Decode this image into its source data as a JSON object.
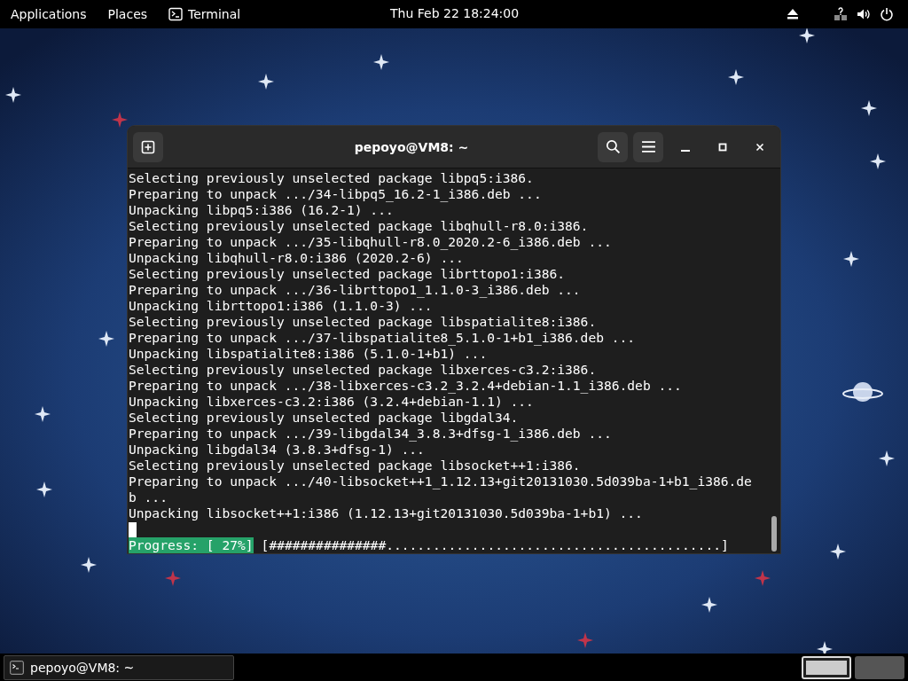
{
  "top_bar": {
    "menus": [
      {
        "label": "Applications"
      },
      {
        "label": "Places"
      }
    ],
    "app": {
      "label": "Terminal"
    },
    "clock": "Thu Feb 22  18:24:00"
  },
  "terminal": {
    "title": "pepoyo@VM8: ~",
    "lines": [
      "Selecting previously unselected package libpq5:i386.",
      "Preparing to unpack .../34-libpq5_16.2-1_i386.deb ...",
      "Unpacking libpq5:i386 (16.2-1) ...",
      "Selecting previously unselected package libqhull-r8.0:i386.",
      "Preparing to unpack .../35-libqhull-r8.0_2020.2-6_i386.deb ...",
      "Unpacking libqhull-r8.0:i386 (2020.2-6) ...",
      "Selecting previously unselected package librttopo1:i386.",
      "Preparing to unpack .../36-librttopo1_1.1.0-3_i386.deb ...",
      "Unpacking librttopo1:i386 (1.1.0-3) ...",
      "Selecting previously unselected package libspatialite8:i386.",
      "Preparing to unpack .../37-libspatialite8_5.1.0-1+b1_i386.deb ...",
      "Unpacking libspatialite8:i386 (5.1.0-1+b1) ...",
      "Selecting previously unselected package libxerces-c3.2:i386.",
      "Preparing to unpack .../38-libxerces-c3.2_3.2.4+debian-1.1_i386.deb ...",
      "Unpacking libxerces-c3.2:i386 (3.2.4+debian-1.1) ...",
      "Selecting previously unselected package libgdal34.",
      "Preparing to unpack .../39-libgdal34_3.8.3+dfsg-1_i386.deb ...",
      "Unpacking libgdal34 (3.8.3+dfsg-1) ...",
      "Selecting previously unselected package libsocket++1:i386.",
      "Preparing to unpack .../40-libsocket++1_1.12.13+git20131030.5d039ba-1+b1_i386.de",
      "b ...",
      "Unpacking libsocket++1:i386 (1.12.13+git20131030.5d039ba-1+b1) ..."
    ],
    "progress_label": "Progress: [ 27%]",
    "progress_bar": "[###############...........................................]"
  },
  "taskbar": {
    "window": {
      "label": "pepoyo@VM8: ~"
    },
    "workspaces": [
      {
        "selected": true
      },
      {
        "selected": false
      }
    ]
  }
}
